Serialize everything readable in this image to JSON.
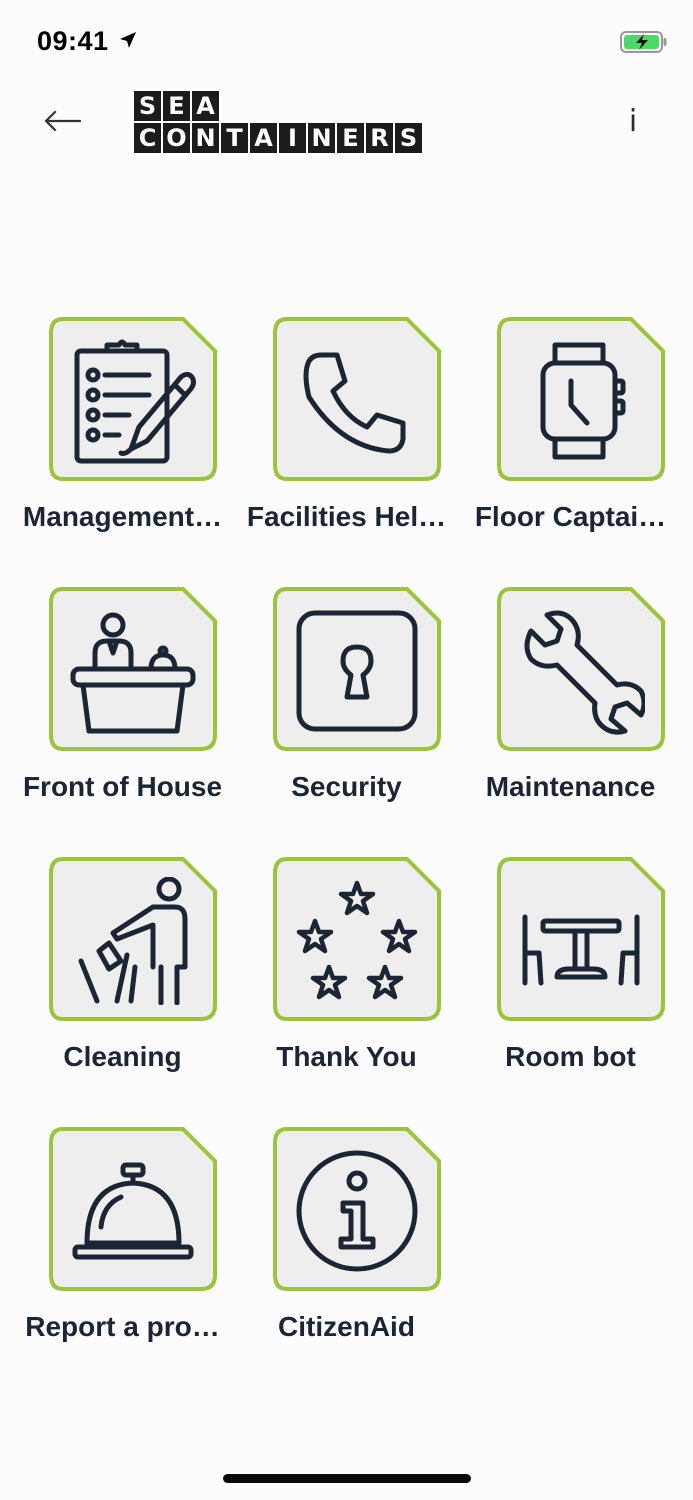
{
  "status_bar": {
    "time": "09:41",
    "icons": [
      "location-arrow-icon",
      "battery-charging-icon"
    ],
    "battery_color": "#4cd964"
  },
  "header": {
    "back_icon": "arrow-left-icon",
    "logo_rows": [
      [
        "S",
        "E",
        "A"
      ],
      [
        "C",
        "O",
        "N",
        "T",
        "A",
        "I",
        "N",
        "E",
        "R",
        "S"
      ]
    ],
    "info_label": "i"
  },
  "theme": {
    "tile_border": "#9bc43c",
    "tile_fill": "#eeeeee",
    "icon_stroke": "#1c2533"
  },
  "tiles": [
    {
      "label": "Management…",
      "icon": "clipboard-checklist-icon"
    },
    {
      "label": "Facilities Hel…",
      "icon": "phone-icon"
    },
    {
      "label": "Floor Captai…",
      "icon": "watch-icon"
    },
    {
      "label": "Front of House",
      "icon": "reception-desk-icon"
    },
    {
      "label": "Security",
      "icon": "keyhole-icon"
    },
    {
      "label": "Maintenance",
      "icon": "wrench-icon"
    },
    {
      "label": "Cleaning",
      "icon": "person-cleaning-icon"
    },
    {
      "label": "Thank You",
      "icon": "stars-circle-icon"
    },
    {
      "label": "Room bot",
      "icon": "table-chairs-icon"
    },
    {
      "label": "Report a pro…",
      "icon": "service-bell-icon"
    },
    {
      "label": "CitizenAid",
      "icon": "info-circle-icon"
    }
  ]
}
